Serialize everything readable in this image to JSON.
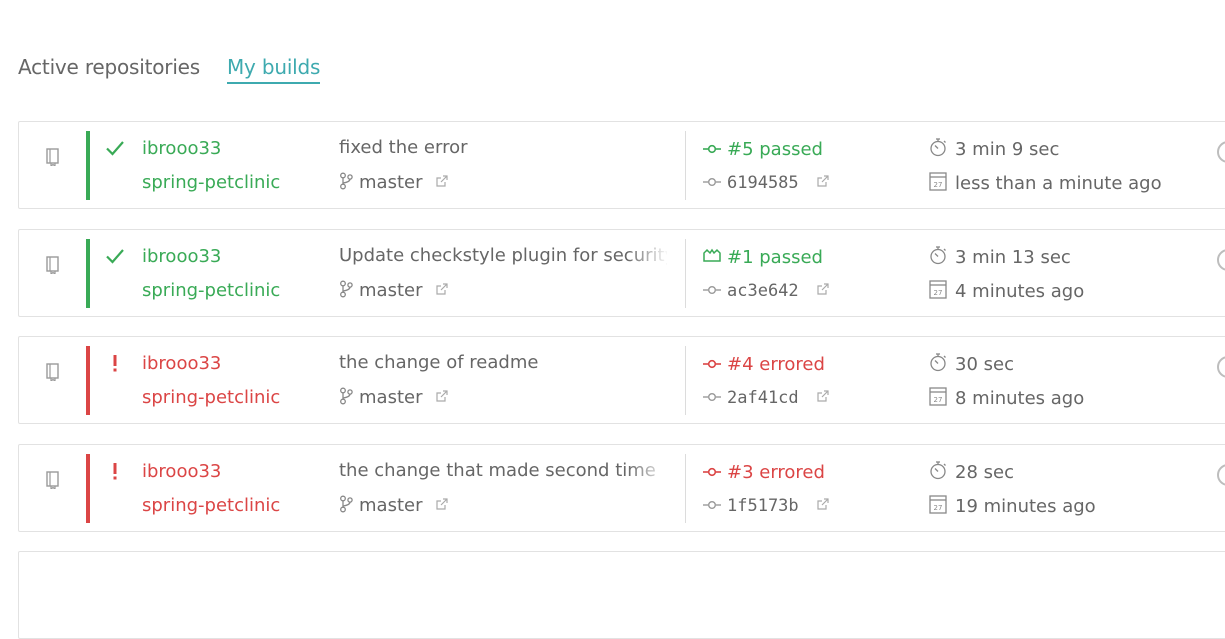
{
  "tabs": [
    {
      "label": "Active repositories",
      "active": false
    },
    {
      "label": "My builds",
      "active": true
    }
  ],
  "colors": {
    "accent": "#3eaaaf",
    "passed": "#39aa56",
    "errored": "#db4545",
    "text": "#666666",
    "border": "#e2e2e2"
  },
  "builds": [
    {
      "state": "passed",
      "state_icon": "check-icon",
      "owner": "ibrooo33",
      "repo": "spring-petclinic",
      "message": "fixed the error",
      "branch": "master",
      "build": "#5 passed",
      "build_icon": "commit-icon",
      "commit": "6194585",
      "duration": "3 min 9 sec",
      "finished": "less than a minute ago"
    },
    {
      "state": "passed",
      "state_icon": "check-icon",
      "owner": "ibrooo33",
      "repo": "spring-petclinic",
      "message": "Update checkstyle plugin for security scan",
      "branch": "master",
      "build": "#1 passed",
      "build_icon": "pull-request-icon",
      "commit": "ac3e642",
      "duration": "3 min 13 sec",
      "finished": "4 minutes ago"
    },
    {
      "state": "errored",
      "state_icon": "exclamation-icon",
      "owner": "ibrooo33",
      "repo": "spring-petclinic",
      "message": "the change of readme",
      "branch": "master",
      "build": "#4 errored",
      "build_icon": "commit-icon",
      "commit": "2af41cd",
      "duration": "30 sec",
      "finished": "8 minutes ago"
    },
    {
      "state": "errored",
      "state_icon": "exclamation-icon",
      "owner": "ibrooo33",
      "repo": "spring-petclinic",
      "message": "the change that made second time",
      "branch": "master",
      "build": "#3 errored",
      "build_icon": "commit-icon",
      "commit": "1f5173b",
      "duration": "28 sec",
      "finished": "19 minutes ago"
    }
  ]
}
